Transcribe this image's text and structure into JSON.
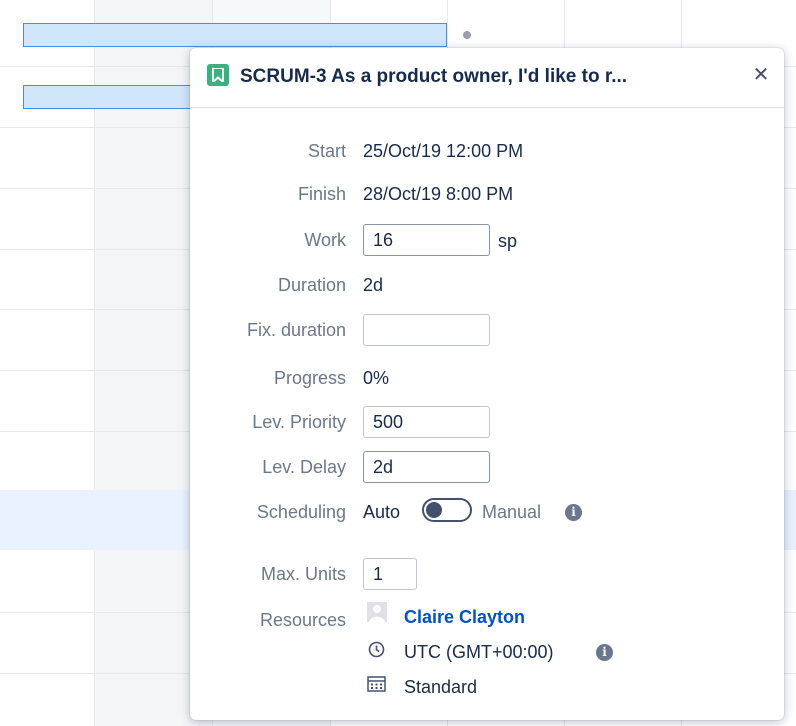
{
  "popup": {
    "title": "SCRUM-3 As a product owner, I'd like to r...",
    "close_symbol": "✕",
    "issue_icon": "bookmark-icon",
    "issue_icon_color": "#36b37e"
  },
  "fields": {
    "start": {
      "label": "Start",
      "value": "25/Oct/19 12:00 PM"
    },
    "finish": {
      "label": "Finish",
      "value": "28/Oct/19 8:00 PM"
    },
    "work": {
      "label": "Work",
      "value": "16",
      "unit": "sp"
    },
    "duration": {
      "label": "Duration",
      "value": "2d"
    },
    "fix_duration": {
      "label": "Fix. duration",
      "value": ""
    },
    "progress": {
      "label": "Progress",
      "value": "0%"
    },
    "lev_priority": {
      "label": "Lev. Priority",
      "value": "500"
    },
    "lev_delay": {
      "label": "Lev. Delay",
      "value": "2d"
    },
    "scheduling": {
      "label": "Scheduling",
      "left_option": "Auto",
      "right_option": "Manual",
      "mode": "Auto"
    },
    "max_units": {
      "label": "Max. Units",
      "value": "1"
    },
    "resources": {
      "label": "Resources",
      "name": "Claire Clayton",
      "timezone": "UTC (GMT+00:00)",
      "calendar": "Standard"
    }
  },
  "colors": {
    "link": "#0052cc",
    "bar_fill": "#cfe6fb",
    "bar_border": "#4a90d9",
    "row_highlight": "#e9f2fd"
  }
}
